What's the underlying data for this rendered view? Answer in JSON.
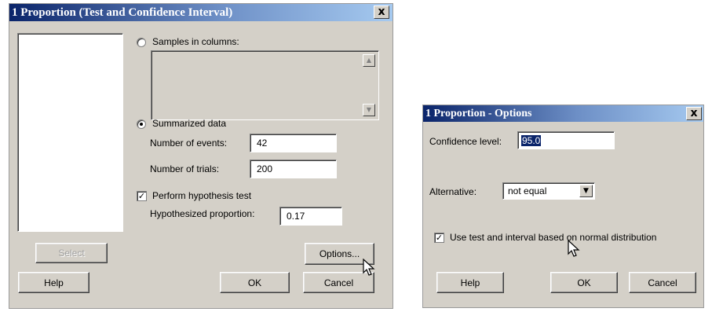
{
  "main_dialog": {
    "title": "1 Proportion (Test and Confidence Interval)",
    "close_label": "x",
    "samples_in_columns_label": "Samples in columns:",
    "summarized_data_label": "Summarized data",
    "events_label": "Number of events:",
    "events_value": "42",
    "trials_label": "Number of trials:",
    "trials_value": "200",
    "perform_test_label": "Perform hypothesis test",
    "perform_test_checked": true,
    "hyp_prop_label": "Hypothesized proportion:",
    "hyp_prop_value": "0.17",
    "select_label": "Select",
    "options_label": "Options...",
    "help_label": "Help",
    "ok_label": "OK",
    "cancel_label": "Cancel",
    "scroll_up_glyph": "▲",
    "scroll_down_glyph": "▼"
  },
  "options_dialog": {
    "title": "1 Proportion - Options",
    "close_label": "x",
    "confidence_label": "Confidence level:",
    "confidence_value": "95.0",
    "alternative_label": "Alternative:",
    "alternative_value": "not equal",
    "dropdown_glyph": "▼",
    "normal_label": "Use test and interval based on normal distribution",
    "normal_checked": true,
    "help_label": "Help",
    "ok_label": "OK",
    "cancel_label": "Cancel"
  },
  "colors": {
    "title_gradient_start": "#0a246a",
    "title_gradient_end": "#a6caf0",
    "dialog_face": "#d4d0c8",
    "selection": "#0a246a"
  },
  "icons": {
    "check_glyph": "✓",
    "cursor": "arrow-pointer-icon"
  }
}
